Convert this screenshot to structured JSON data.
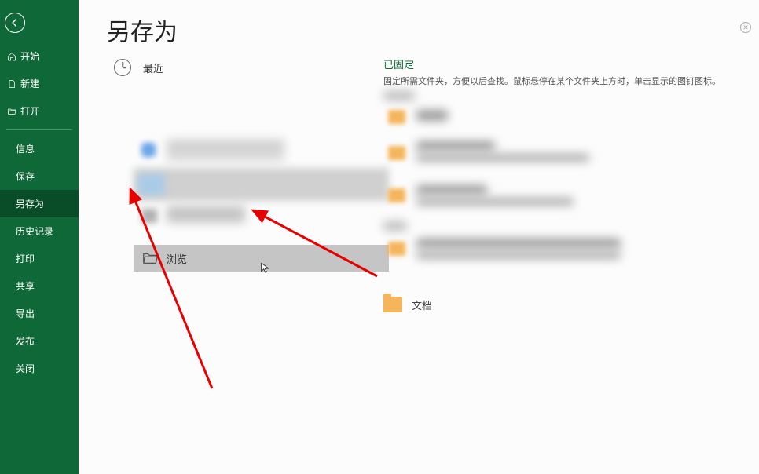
{
  "page": {
    "title": "另存为"
  },
  "sidebar": {
    "items": [
      {
        "label": "开始",
        "icon": "home"
      },
      {
        "label": "新建",
        "icon": "new"
      },
      {
        "label": "打开",
        "icon": "open"
      }
    ],
    "items2": [
      {
        "label": "信息"
      },
      {
        "label": "保存"
      },
      {
        "label": "另存为",
        "selected": true
      },
      {
        "label": "历史记录"
      },
      {
        "label": "打印"
      },
      {
        "label": "共享"
      },
      {
        "label": "导出"
      },
      {
        "label": "发布"
      },
      {
        "label": "关闭"
      }
    ]
  },
  "locations": {
    "recent": "最近",
    "browse": "浏览"
  },
  "details": {
    "pinned_title": "已固定",
    "pinned_help": "固定所需文件夹，方便以后查找。鼠标悬停在某个文件夹上方时，单击显示的图钉图标。",
    "documents": "文档"
  }
}
